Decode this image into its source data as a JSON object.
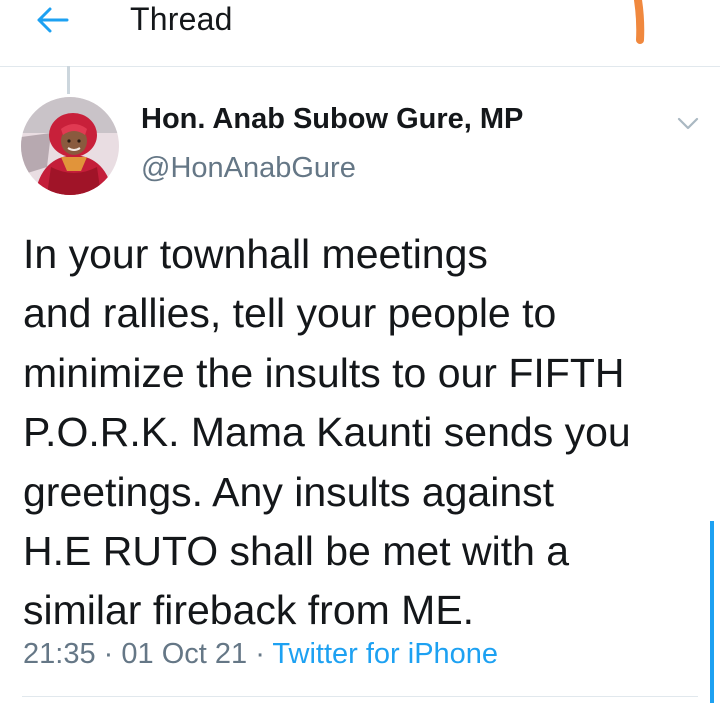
{
  "header": {
    "title": "Thread"
  },
  "author": {
    "display_name": "Hon. Anab Subow Gure, MP",
    "handle": "@HonAnabGure"
  },
  "tweet": {
    "text": "In your townhall meetings\nand rallies, tell your people to\nminimize the insults to our FIFTH\nP.O.R.K.  Mama Kaunti sends you\ngreetings. Any insults against\nH.E RUTO shall be met with a\nsimilar fireback from ME.",
    "time": "21:35",
    "separator": "·",
    "date": "01 Oct 21",
    "source": "Twitter for iPhone"
  },
  "icons": {
    "back": "arrow-left-icon",
    "more": "chevron-down-icon"
  },
  "colors": {
    "accent": "#1da1f2",
    "secondary_text": "#657786",
    "primary_text": "#14171a",
    "divider": "#e1e8ed",
    "orange_mark": "#f0883e"
  }
}
